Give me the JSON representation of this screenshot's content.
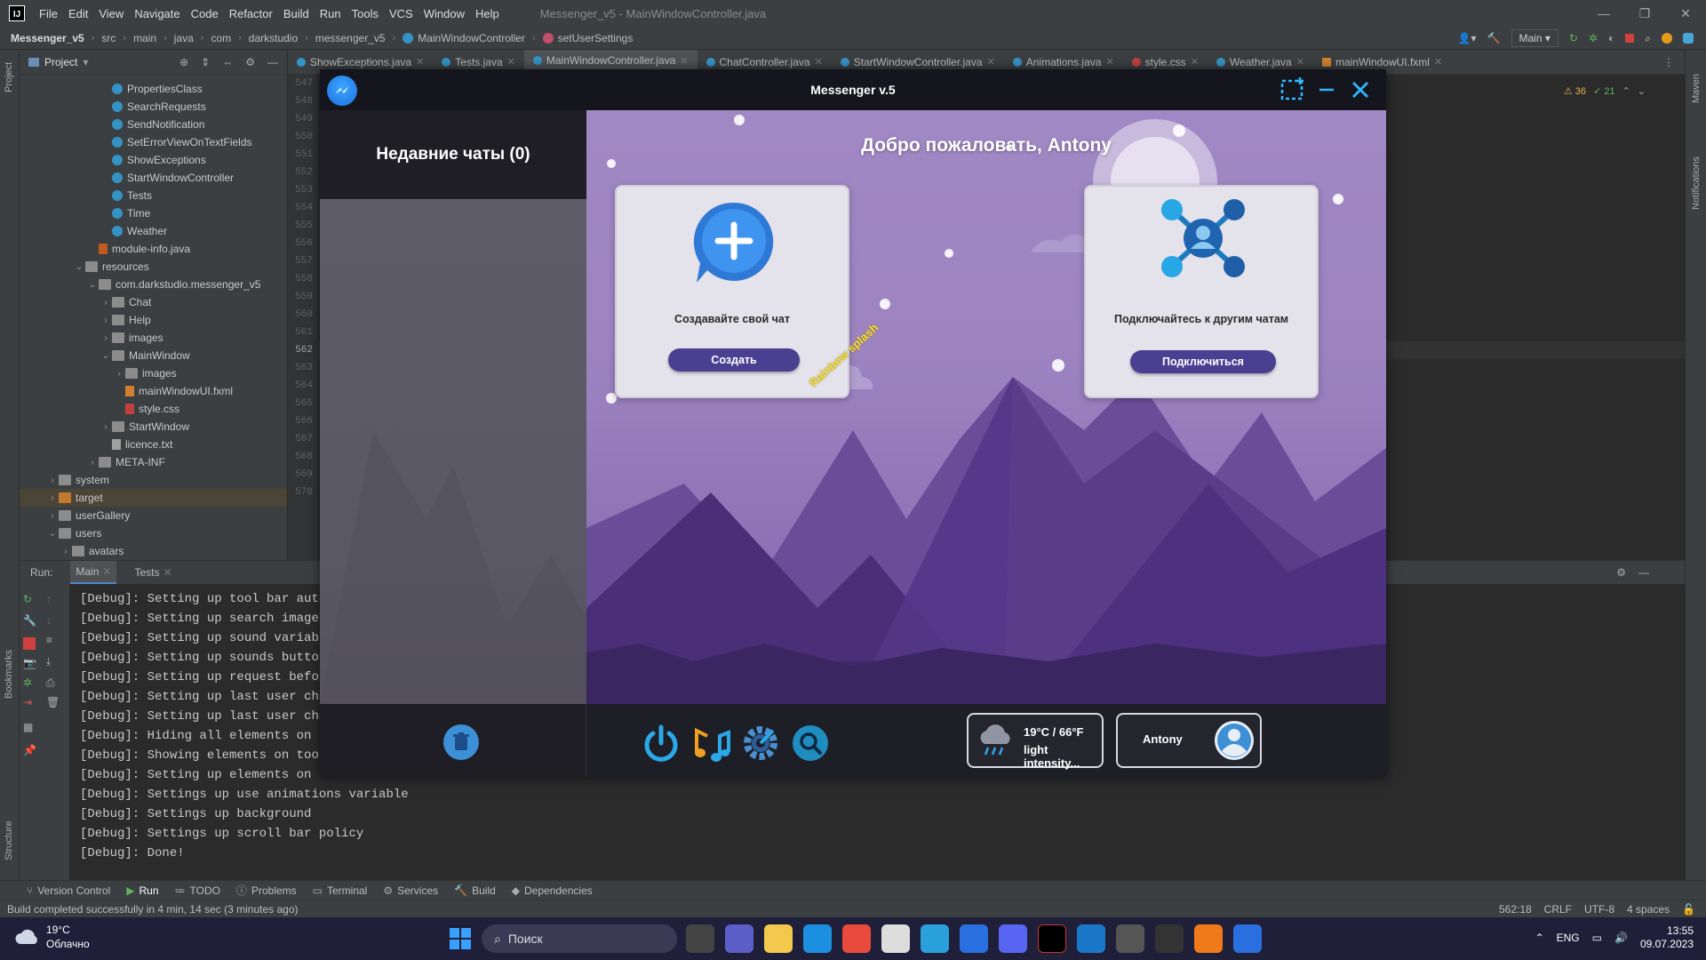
{
  "ide": {
    "logo": "IJ",
    "menu": [
      "File",
      "Edit",
      "View",
      "Navigate",
      "Code",
      "Refactor",
      "Build",
      "Run",
      "Tools",
      "VCS",
      "Window",
      "Help"
    ],
    "window_title": "Messenger_v5 - MainWindowController.java",
    "breadcrumb": [
      "Messenger_v5",
      "src",
      "main",
      "java",
      "com",
      "darkstudio",
      "messenger_v5",
      "MainWindowController",
      "setUserSettings"
    ],
    "run_config": "Main",
    "project_label": "Project",
    "tree": [
      {
        "label": "PropertiesClass",
        "type": "class",
        "depth": 6
      },
      {
        "label": "SearchRequests",
        "type": "class",
        "depth": 6
      },
      {
        "label": "SendNotification",
        "type": "class",
        "depth": 6
      },
      {
        "label": "SetErrorViewOnTextFields",
        "type": "class",
        "depth": 6
      },
      {
        "label": "ShowExceptions",
        "type": "class",
        "depth": 6
      },
      {
        "label": "StartWindowController",
        "type": "class",
        "depth": 6
      },
      {
        "label": "Tests",
        "type": "class",
        "depth": 6
      },
      {
        "label": "Time",
        "type": "class",
        "depth": 6
      },
      {
        "label": "Weather",
        "type": "class",
        "depth": 6
      },
      {
        "label": "module-info.java",
        "type": "java",
        "depth": 5
      },
      {
        "label": "resources",
        "type": "folder",
        "depth": 4,
        "arrow": "v"
      },
      {
        "label": "com.darkstudio.messenger_v5",
        "type": "folder",
        "depth": 5,
        "arrow": "v"
      },
      {
        "label": "Chat",
        "type": "folder",
        "depth": 6,
        "arrow": ">"
      },
      {
        "label": "Help",
        "type": "folder",
        "depth": 6,
        "arrow": ">"
      },
      {
        "label": "images",
        "type": "folder",
        "depth": 6,
        "arrow": ">"
      },
      {
        "label": "MainWindow",
        "type": "folder",
        "depth": 6,
        "arrow": "v"
      },
      {
        "label": "images",
        "type": "folder",
        "depth": 7,
        "arrow": ">"
      },
      {
        "label": "mainWindowUI.fxml",
        "type": "xml",
        "depth": 7
      },
      {
        "label": "style.css",
        "type": "css",
        "depth": 7
      },
      {
        "label": "StartWindow",
        "type": "folder",
        "depth": 6,
        "arrow": ">"
      },
      {
        "label": "licence.txt",
        "type": "file",
        "depth": 6
      },
      {
        "label": "META-INF",
        "type": "folder",
        "depth": 5,
        "arrow": ">"
      },
      {
        "label": "system",
        "type": "folder",
        "depth": 2,
        "arrow": ">"
      },
      {
        "label": "target",
        "type": "folder-o",
        "depth": 2,
        "arrow": ">",
        "selected": true
      },
      {
        "label": "userGallery",
        "type": "folder",
        "depth": 2,
        "arrow": ">"
      },
      {
        "label": "users",
        "type": "folder",
        "depth": 2,
        "arrow": "v"
      },
      {
        "label": "avatars",
        "type": "folder",
        "depth": 3,
        "arrow": ">"
      }
    ],
    "tabs": [
      {
        "label": "ShowExceptions.java",
        "active": false
      },
      {
        "label": "Tests.java",
        "active": false
      },
      {
        "label": "MainWindowController.java",
        "active": true
      },
      {
        "label": "ChatController.java",
        "active": false
      },
      {
        "label": "StartWindowController.java",
        "active": false
      },
      {
        "label": "Animations.java",
        "active": false
      },
      {
        "label": "style.css",
        "active": false
      },
      {
        "label": "Weather.java",
        "active": false
      },
      {
        "label": "mainWindowUI.fxml",
        "active": false
      }
    ],
    "line_numbers": [
      "547",
      "548",
      "549",
      "550",
      "551",
      "552",
      "553",
      "554",
      "555",
      "556",
      "557",
      "558",
      "559",
      "560",
      "561",
      "562",
      "563",
      "564",
      "565",
      "566",
      "567",
      "568",
      "569",
      "570"
    ],
    "current_line": "562",
    "inspections": {
      "warnings": "36",
      "ok": "21"
    },
    "run_tabs": [
      {
        "label": "Run:",
        "active": false
      },
      {
        "label": "Main",
        "active": true
      },
      {
        "label": "Tests",
        "active": false
      }
    ],
    "console": [
      "[Debug]: Setting up tool bar auto",
      "[Debug]: Setting up search images",
      "[Debug]: Setting up sound variable",
      "[Debug]: Setting up sounds button",
      "[Debug]: Setting up request before",
      "[Debug]: Setting up last user chat",
      "[Debug]: Setting up last user chat",
      "[Debug]: Hiding all elements on to",
      "[Debug]: Showing elements on tool",
      "[Debug]: Setting up elements on to",
      "[Debug]: Settings up use animations variable",
      "[Debug]: Settings up background",
      "[Debug]: Settings up scroll bar policy",
      "[Debug]: Done!"
    ],
    "bottom_tools": [
      {
        "label": "Version Control",
        "active": false
      },
      {
        "label": "Run",
        "active": true
      },
      {
        "label": "TODO",
        "active": false
      },
      {
        "label": "Problems",
        "active": false
      },
      {
        "label": "Terminal",
        "active": false
      },
      {
        "label": "Services",
        "active": false
      },
      {
        "label": "Build",
        "active": false
      },
      {
        "label": "Dependencies",
        "active": false
      }
    ],
    "status": "Build completed successfully in 4 min, 14 sec (3 minutes ago)",
    "status_right": {
      "position": "562:18",
      "line_sep": "CRLF",
      "encoding": "UTF-8",
      "indent": "4 spaces"
    },
    "side_labels": {
      "project": "Project",
      "bookmarks": "Bookmarks",
      "structure": "Structure",
      "maven": "Maven",
      "notifications": "Notifications"
    }
  },
  "messenger": {
    "title": "Messenger v.5",
    "recent_chats": "Недавние чаты (0)",
    "welcome": "Добро пожаловать, Antony",
    "create_card": {
      "text": "Создавайте свой чат",
      "button": "Создать"
    },
    "connect_card": {
      "text": "Подключайтесь к другим чатам",
      "button": "Подключиться"
    },
    "rainbow": "Rainbow splash",
    "weather": {
      "temp": "19°C / 66°F",
      "desc": "light intensity..."
    },
    "user": "Antony",
    "colors": {
      "accent": "#4b3f92",
      "sky": "#a088c4",
      "mountain": "#4c2f7a",
      "icon_blue": "#3d8fd6"
    }
  },
  "taskbar": {
    "weather_temp": "19°C",
    "weather_desc": "Облачно",
    "search": "Поиск",
    "lang": "ENG",
    "time": "13:55",
    "date": "09.07.2023"
  }
}
